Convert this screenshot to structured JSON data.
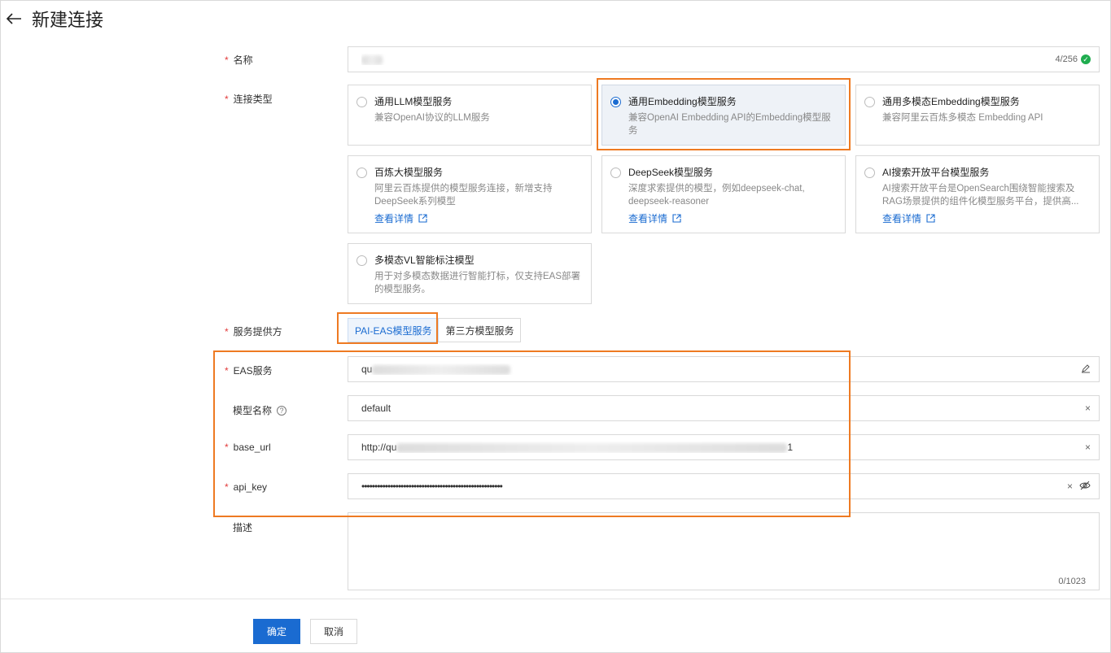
{
  "page": {
    "title": "新建连接"
  },
  "form": {
    "name": {
      "label": "名称",
      "value": "",
      "counter": "4/256"
    },
    "connection_type": {
      "label": "连接类型",
      "options": [
        {
          "title": "通用LLM模型服务",
          "desc": "兼容OpenAI协议的LLM服务"
        },
        {
          "title": "通用Embedding模型服务",
          "desc": "兼容OpenAI Embedding API的Embedding模型服务"
        },
        {
          "title": "通用多模态Embedding模型服务",
          "desc": "兼容阿里云百炼多模态 Embedding API"
        },
        {
          "title": "百炼大模型服务",
          "desc": "阿里云百炼提供的模型服务连接，新增支持DeepSeek系列模型",
          "link": "查看详情"
        },
        {
          "title": "DeepSeek模型服务",
          "desc": "深度求索提供的模型，例如deepseek-chat, deepseek-reasoner",
          "link": "查看详情"
        },
        {
          "title": "AI搜索开放平台模型服务",
          "desc": "AI搜索开放平台是OpenSearch围绕智能搜索及RAG场景提供的组件化模型服务平台，提供高...",
          "link": "查看详情"
        },
        {
          "title": "多模态VL智能标注模型",
          "desc": "用于对多模态数据进行智能打标，仅支持EAS部署的模型服务。"
        }
      ],
      "selected": "通用Embedding模型服务"
    },
    "provider": {
      "label": "服务提供方",
      "options": [
        "PAI-EAS模型服务",
        "第三方模型服务"
      ],
      "selected": "PAI-EAS模型服务"
    },
    "eas_service": {
      "label": "EAS服务",
      "value_prefix": "qu"
    },
    "model_name": {
      "label": "模型名称",
      "value": "default"
    },
    "base_url": {
      "label": "base_url",
      "value_prefix": "http://qu",
      "value_suffix": "1"
    },
    "api_key": {
      "label": "api_key",
      "value": "••••••••••••••••••••••••••••••••••••••••••••••••••••••"
    },
    "description": {
      "label": "描述",
      "value": "",
      "counter": "0/1023"
    }
  },
  "actions": {
    "confirm": "确定",
    "cancel": "取消"
  },
  "colors": {
    "accent": "#1a6bd1",
    "highlight": "#ee7a22",
    "required": "#e23b3b",
    "success": "#1fad4f"
  }
}
